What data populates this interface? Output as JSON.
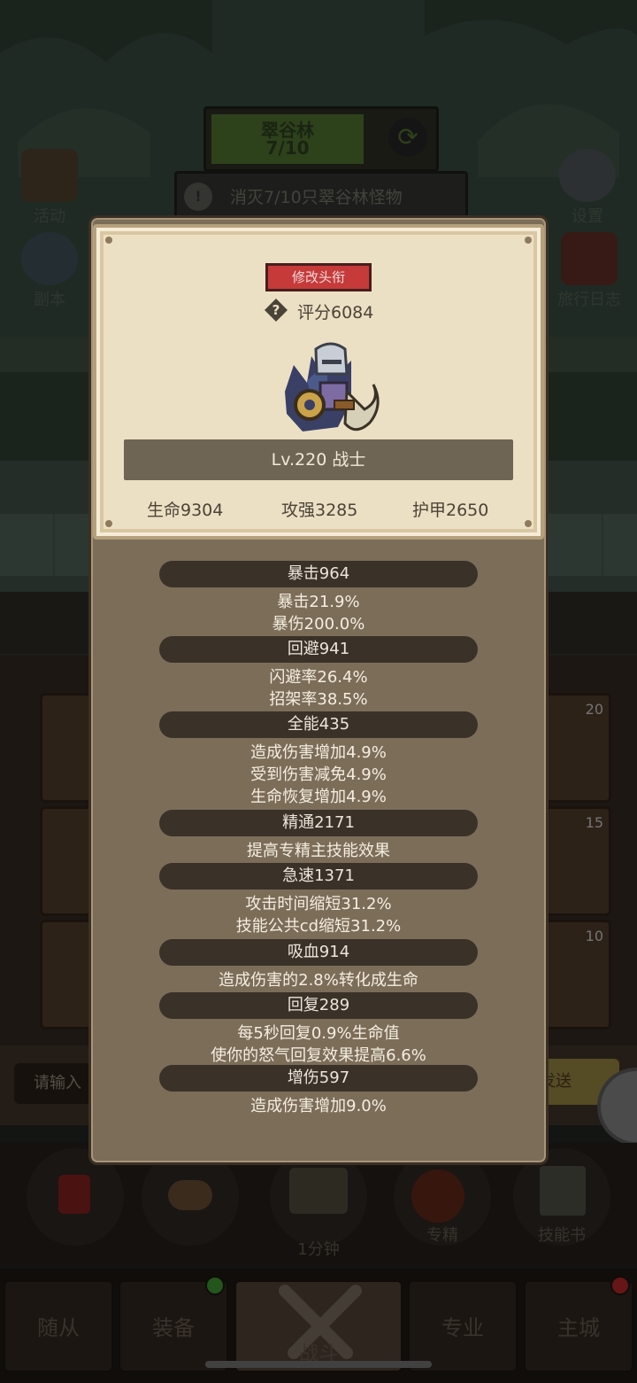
{
  "background": {
    "zone": {
      "name": "翠谷林",
      "progress": "7/10"
    },
    "quest": {
      "text": "消灭7/10只翠谷林怪物"
    },
    "left_icons": [
      {
        "label": "活动"
      },
      {
        "label": "副本"
      }
    ],
    "right_icons": [
      {
        "label": "设置"
      },
      {
        "label": "旅行日志"
      }
    ],
    "slot_counts": [
      "20",
      "15",
      "10"
    ],
    "chat": {
      "placeholder": "请输入",
      "send_label": "发送"
    },
    "actions": [
      {
        "label": ""
      },
      {
        "label": ""
      },
      {
        "label": "1分钟"
      },
      {
        "label": "专精"
      },
      {
        "label": "技能书"
      }
    ],
    "nav": [
      {
        "label": "随从"
      },
      {
        "label": "装备",
        "badge": "green"
      },
      {
        "label": "战斗"
      },
      {
        "label": "专业"
      },
      {
        "label": "主城",
        "badge": "red"
      }
    ]
  },
  "popup": {
    "rename_button": "修改头衔",
    "score": "评分6084",
    "level_class": "Lv.220 战士",
    "base_stats": [
      "生命9304",
      "攻强3285",
      "护甲2650"
    ],
    "stat_groups": [
      {
        "title": "暴击964",
        "details": [
          "暴击21.9%",
          "暴伤200.0%"
        ]
      },
      {
        "title": "回避941",
        "details": [
          "闪避率26.4%",
          "招架率38.5%"
        ]
      },
      {
        "title": "全能435",
        "details": [
          "造成伤害增加4.9%",
          "受到伤害减免4.9%",
          "生命恢复增加4.9%"
        ]
      },
      {
        "title": "精通2171",
        "details": [
          "提高专精主技能效果"
        ]
      },
      {
        "title": "急速1371",
        "details": [
          "攻击时间缩短31.2%",
          "技能公共cd缩短31.2%"
        ]
      },
      {
        "title": "吸血914",
        "details": [
          "造成伤害的2.8%转化成生命"
        ]
      },
      {
        "title": "回复289",
        "details": [
          "每5秒回复0.9%生命值",
          "使你的怒气回复效果提高6.6%"
        ]
      },
      {
        "title": "增伤597",
        "details": [
          "造成伤害增加9.0%"
        ]
      }
    ]
  },
  "colors": {
    "panel": "#7c6d59",
    "card": "#ece0c4",
    "pill": "#3a3129",
    "rename_button": "#c63a3a"
  }
}
